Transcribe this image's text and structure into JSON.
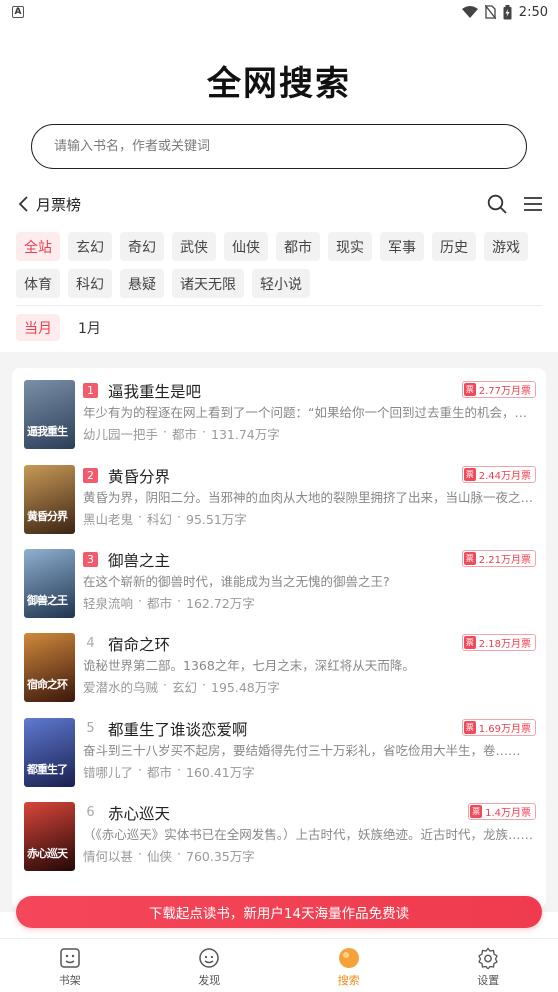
{
  "status_bar": {
    "time": "2:50",
    "badge": "A"
  },
  "header": {
    "title": "全网搜索"
  },
  "search": {
    "placeholder": "请输入书名，作者或关键词"
  },
  "rank": {
    "title": "月票榜"
  },
  "categories": [
    "全站",
    "玄幻",
    "奇幻",
    "武侠",
    "仙侠",
    "都市",
    "现实",
    "军事",
    "历史",
    "游戏",
    "体育",
    "科幻",
    "悬疑",
    "诸天无限",
    "轻小说"
  ],
  "periods": [
    "当月",
    "1月"
  ],
  "books": [
    {
      "rank": "1",
      "title": "逼我重生是吧",
      "tickets": "2.77万月票",
      "desc": "年少有为的程逐在网上看到了一个问题：“如果给你一个回到过去重生的机会，你愿意吗？”",
      "author": "幼儿园一把手",
      "genre": "都市",
      "words": "131.74万字",
      "cover_text": "逼我重生",
      "cover_color": "#2c3e57"
    },
    {
      "rank": "2",
      "title": "黄昏分界",
      "tickets": "2.44万月票",
      "desc": "黄昏为界，阴阳二分。当邪神的血肉从大地的裂隙里拥挤了出来，当山脉一夜之间崩塌……",
      "author": "黑山老鬼",
      "genre": "科幻",
      "words": "95.51万字",
      "cover_text": "黄昏分界",
      "cover_color": "#6b4a2a"
    },
    {
      "rank": "3",
      "title": "御兽之主",
      "tickets": "2.21万月票",
      "desc": "在这个崭新的御兽时代，谁能成为当之无愧的御兽之王?",
      "author": "轻泉流响",
      "genre": "都市",
      "words": "162.72万字",
      "cover_text": "御兽之王",
      "cover_color": "#2f4a66"
    },
    {
      "rank": "4",
      "title": "宿命之环",
      "tickets": "2.18万月票",
      "desc": "诡秘世界第二部。1368之年，七月之末，深红将从天而降。",
      "author": "爱潜水的乌贼",
      "genre": "玄幻",
      "words": "195.48万字",
      "cover_text": "宿命之环",
      "cover_color": "#5a2a1c"
    },
    {
      "rank": "5",
      "title": "都重生了谁谈恋爱啊",
      "tickets": "1.69万月票",
      "desc": "奋斗到三十八岁买不起房，要结婚得先付三十万彩礼，省吃俭用大半生，卷……",
      "author": "错哪儿了",
      "genre": "都市",
      "words": "160.41万字",
      "cover_text": "都重生了",
      "cover_color": "#2b3d7a"
    },
    {
      "rank": "6",
      "title": "赤心巡天",
      "tickets": "1.4万月票",
      "desc": "（《赤心巡天》实体书已在全网发售。）上古时代，妖族绝迹。近古时代，龙族……",
      "author": "情何以甚",
      "genre": "仙侠",
      "words": "760.35万字",
      "cover_text": "赤心巡天",
      "cover_color": "#3a1616"
    }
  ],
  "promo": {
    "text": "下载起点读书，新用户14天海量作品免费读"
  },
  "tabs": [
    {
      "label": "书架",
      "icon": "bookshelf-icon"
    },
    {
      "label": "发现",
      "icon": "discover-icon"
    },
    {
      "label": "搜索",
      "icon": "search-orb-icon"
    },
    {
      "label": "设置",
      "icon": "settings-icon"
    }
  ],
  "colors": {
    "accent": "#ef3d4e",
    "active_tab": "#f08a1d",
    "chip_bg": "#f2f2f2",
    "list_bg": "#f4f4f4"
  }
}
